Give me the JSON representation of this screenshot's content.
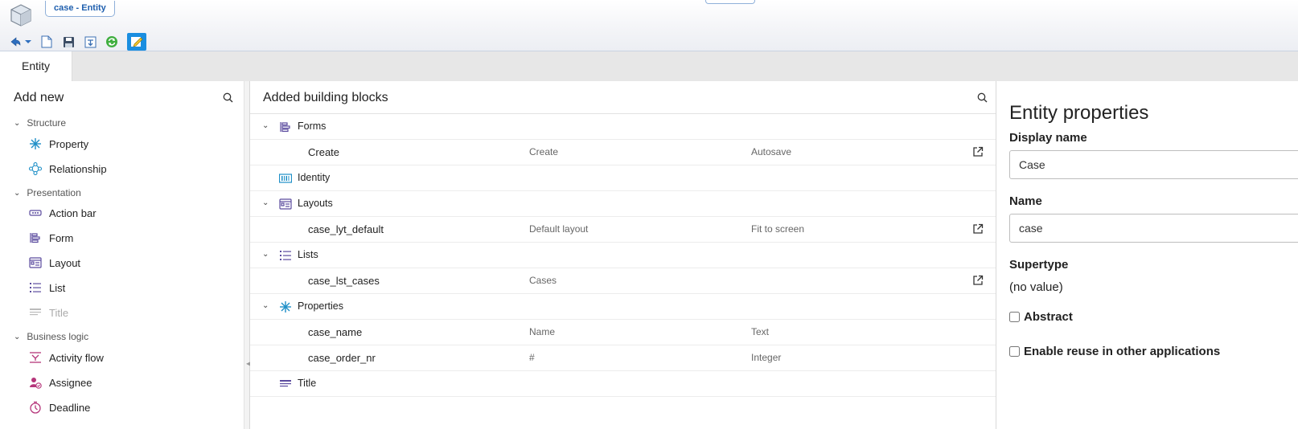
{
  "window": {
    "document_tab": "case - Entity"
  },
  "toolbar": {
    "items": [
      {
        "name": "back-icon"
      },
      {
        "name": "dropdown-icon"
      },
      {
        "name": "new-document-icon"
      },
      {
        "name": "save-icon"
      },
      {
        "name": "save-as-icon"
      },
      {
        "name": "refresh-icon"
      },
      {
        "name": "edit-icon"
      }
    ]
  },
  "tabs": [
    {
      "label": "Entity",
      "active": true
    }
  ],
  "left": {
    "heading": "Add new",
    "groups": [
      {
        "label": "Structure",
        "items": [
          {
            "label": "Property",
            "icon": "asterisk-icon"
          },
          {
            "label": "Relationship",
            "icon": "relationship-icon"
          }
        ]
      },
      {
        "label": "Presentation",
        "items": [
          {
            "label": "Action bar",
            "icon": "action-bar-icon"
          },
          {
            "label": "Form",
            "icon": "form-icon"
          },
          {
            "label": "Layout",
            "icon": "layout-icon"
          },
          {
            "label": "List",
            "icon": "list-icon"
          },
          {
            "label": "Title",
            "icon": "title-icon",
            "disabled": true
          }
        ]
      },
      {
        "label": "Business logic",
        "items": [
          {
            "label": "Activity flow",
            "icon": "activity-flow-icon"
          },
          {
            "label": "Assignee",
            "icon": "assignee-icon"
          },
          {
            "label": "Deadline",
            "icon": "deadline-icon"
          }
        ]
      }
    ]
  },
  "middle": {
    "heading": "Added building blocks",
    "rows": [
      {
        "type": "group",
        "label": "Forms",
        "icon": "form-icon",
        "expanded": true
      },
      {
        "type": "child",
        "name": "Create",
        "col2": "Create",
        "col3": "Autosave",
        "open": true
      },
      {
        "type": "group",
        "label": "Identity",
        "icon": "identity-icon",
        "expanded": false
      },
      {
        "type": "group",
        "label": "Layouts",
        "icon": "layout-icon",
        "expanded": true
      },
      {
        "type": "child",
        "name": "case_lyt_default",
        "col2": "Default layout",
        "col3": "Fit to screen",
        "open": true
      },
      {
        "type": "group",
        "label": "Lists",
        "icon": "list-icon",
        "expanded": true
      },
      {
        "type": "child",
        "name": "case_lst_cases",
        "col2": "Cases",
        "col3": "",
        "open": true
      },
      {
        "type": "group",
        "label": "Properties",
        "icon": "asterisk-icon",
        "expanded": true
      },
      {
        "type": "child",
        "name": "case_name",
        "col2": "Name",
        "col3": "Text",
        "open": false
      },
      {
        "type": "child",
        "name": "case_order_nr",
        "col2": "#",
        "col3": "Integer",
        "open": false
      },
      {
        "type": "group",
        "label": "Title",
        "icon": "title-icon",
        "expanded": false
      }
    ]
  },
  "right": {
    "title": "Entity properties",
    "display_name_label": "Display name",
    "display_name_value": "Case",
    "name_label": "Name",
    "name_value": "case",
    "supertype_label": "Supertype",
    "supertype_value": "(no value)",
    "abstract_label": "Abstract",
    "abstract_checked": false,
    "reuse_label": "Enable reuse in other applications",
    "reuse_checked": false
  },
  "colors": {
    "accent": "#1a8ee0",
    "icon_purple": "#5b4b9e",
    "icon_teal": "#1e8fc7",
    "icon_pink": "#b5357a"
  }
}
